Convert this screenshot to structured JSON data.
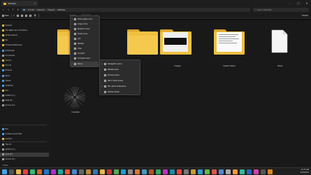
{
  "window": {
    "tab_title": "Websites",
    "minimize": "–",
    "maximize": "□",
    "close": "✕"
  },
  "address": {
    "crumbs": [
      "This PC",
      "Data (E:)",
      "Projects",
      "Websites"
    ],
    "separator": "›",
    "search_placeholder": "Search Websites"
  },
  "toolbar": {
    "new": "New",
    "sort": "Sort",
    "view": "View",
    "more": "···",
    "details": "Details"
  },
  "sidebar": {
    "items": [
      {
        "label": "Projects",
        "color": "yellow"
      },
      {
        "label": "The Night Land of Dreams",
        "color": "yellow"
      },
      {
        "label": "Family Albums",
        "color": "yellow"
      },
      {
        "label": "Fav",
        "color": "yellow"
      },
      {
        "label": "Drawing References",
        "color": "yellow"
      },
      {
        "label": "Downloads",
        "color": "blue"
      },
      {
        "label": "Documents",
        "color": "gray"
      },
      {
        "label": "Comics",
        "color": "yellow"
      },
      {
        "label": "How To",
        "color": "yellow"
      },
      {
        "label": "Pictures",
        "color": "blue"
      },
      {
        "label": "Music",
        "color": "blue"
      },
      {
        "label": "Videos",
        "color": "blue"
      },
      {
        "label": "OneDrive",
        "color": "blue"
      },
      {
        "label": "Pics",
        "color": "yellow"
      },
      {
        "label": "System (C:)",
        "color": "gray"
      },
      {
        "label": "Data (E:)",
        "color": "gray"
      },
      {
        "label": "Drivers (D:)",
        "color": "gray"
      },
      {
        "label": "Box",
        "color": "blue"
      },
      {
        "label": "Creative Cloud Files",
        "color": "blue"
      },
      {
        "label": "Audition",
        "color": "yellow"
      },
      {
        "label": "This PC",
        "color": "gray"
      },
      {
        "label": "System (C:)",
        "color": "gray"
      },
      {
        "label": "Data (E:)",
        "color": "gray"
      },
      {
        "label": "Drivers (D:)",
        "color": "gray"
      }
    ]
  },
  "content": {
    "items": [
      {
        "label": "",
        "kind": "folder-plain"
      },
      {
        "label": "",
        "kind": "folder-plain"
      },
      {
        "label": "",
        "kind": "folder-plain"
      },
      {
        "label": "Images",
        "kind": "folder-image"
      },
      {
        "label": "System Setup",
        "kind": "folder-doc"
      },
      {
        "label": "Blank",
        "kind": "file-blank"
      },
      {
        "label": "Unempty",
        "kind": "starburst"
      }
    ]
  },
  "view_menu": {
    "items": [
      {
        "label": "Extra large icons",
        "checked": true,
        "submenu": false
      },
      {
        "label": "Large icons",
        "checked": false,
        "submenu": false
      },
      {
        "label": "Medium icons",
        "checked": false,
        "submenu": false
      },
      {
        "label": "Small icons",
        "checked": false,
        "submenu": false
      },
      {
        "label": "List",
        "checked": false,
        "submenu": false
      },
      {
        "label": "Details",
        "checked": false,
        "submenu": false
      },
      {
        "label": "Tiles",
        "checked": false,
        "submenu": false
      },
      {
        "label": "Content",
        "checked": false,
        "submenu": false
      },
      {
        "label": "Compact view",
        "checked": false,
        "submenu": false
      },
      {
        "label": "Show",
        "checked": false,
        "submenu": true
      }
    ]
  },
  "show_submenu": {
    "items": [
      {
        "label": "Navigation pane",
        "checked": true
      },
      {
        "label": "Details pane",
        "checked": false
      },
      {
        "label": "Preview pane",
        "checked": false
      },
      {
        "label": "Item check boxes",
        "checked": false
      },
      {
        "label": "File name extensions",
        "checked": true
      },
      {
        "label": "Hidden items",
        "checked": false
      }
    ]
  },
  "status": {
    "count": "7 items"
  },
  "tray": {
    "time": "11:53 AM",
    "date": "3/25/2024"
  },
  "colors": {
    "folder": "#f0c040",
    "accent": "#4a9fe8",
    "bg": "#191919"
  }
}
